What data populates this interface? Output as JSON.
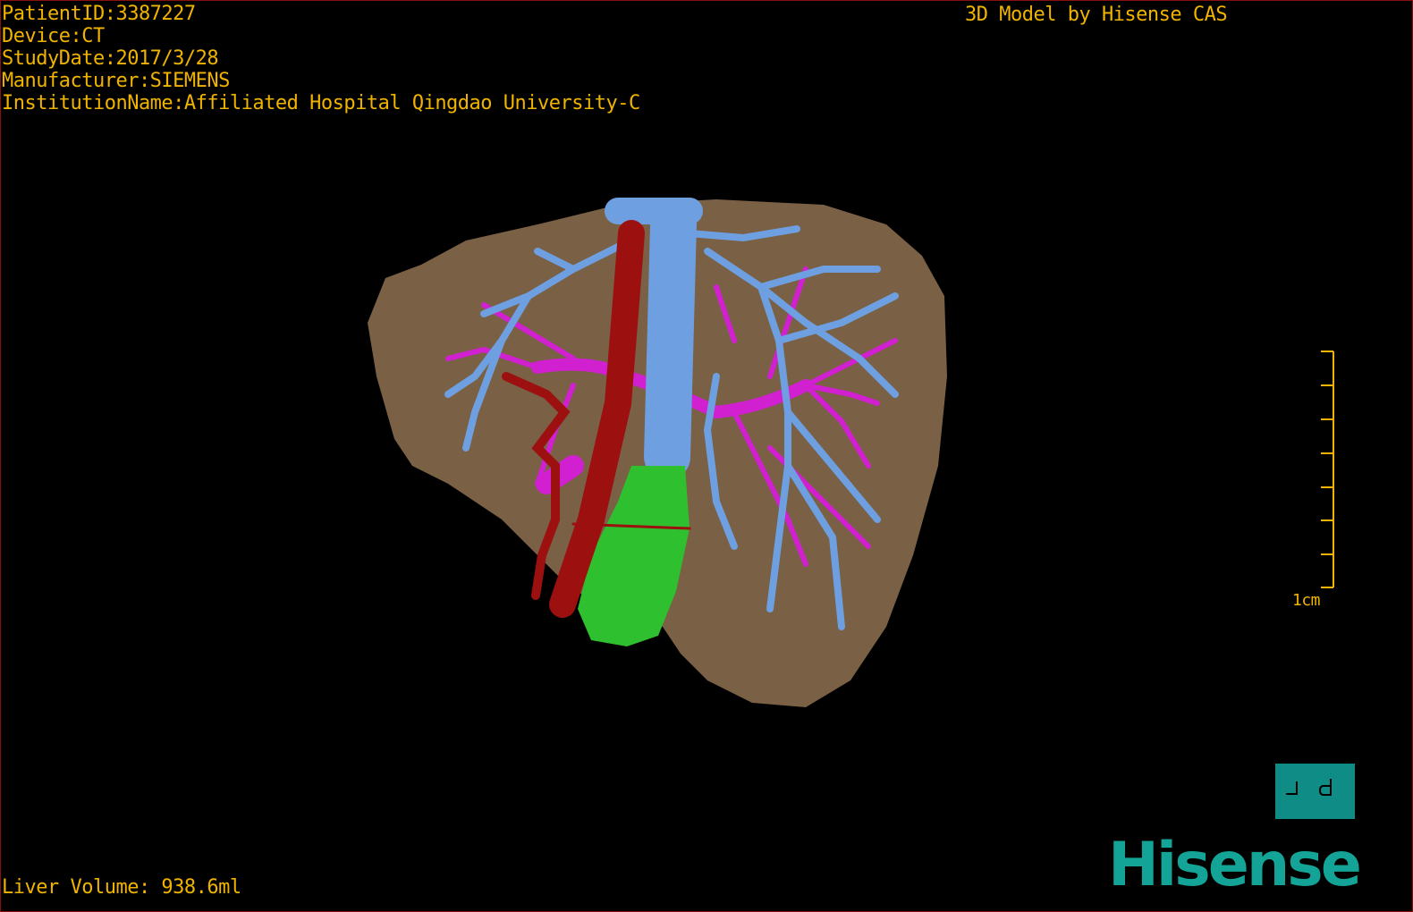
{
  "info": {
    "patient_id": "PatientID:3387227",
    "device": "Device:CT",
    "study_date": "StudyDate:2017/3/28",
    "manufacturer": "Manufacturer:SIEMENS",
    "institution": "InstitutionName:Affiliated Hospital Qingdao University-C"
  },
  "credit": "3D Model by Hisense CAS",
  "liver_volume": "Liver Volume: 938.6ml",
  "scale_bar": {
    "label": "1cm",
    "color": "#f0b400"
  },
  "view_button": {
    "icon": "view-orientation-icon",
    "color": "#0f8c86"
  },
  "logo": "Hisense",
  "colors": {
    "text": "#f0b400",
    "liver": "#7a6044",
    "hepatic_vein": "#6e9fe0",
    "portal_vein": "#d020d0",
    "artery": "#9c1010",
    "gallbladder": "#2fc02f",
    "logo": "#14a497"
  }
}
